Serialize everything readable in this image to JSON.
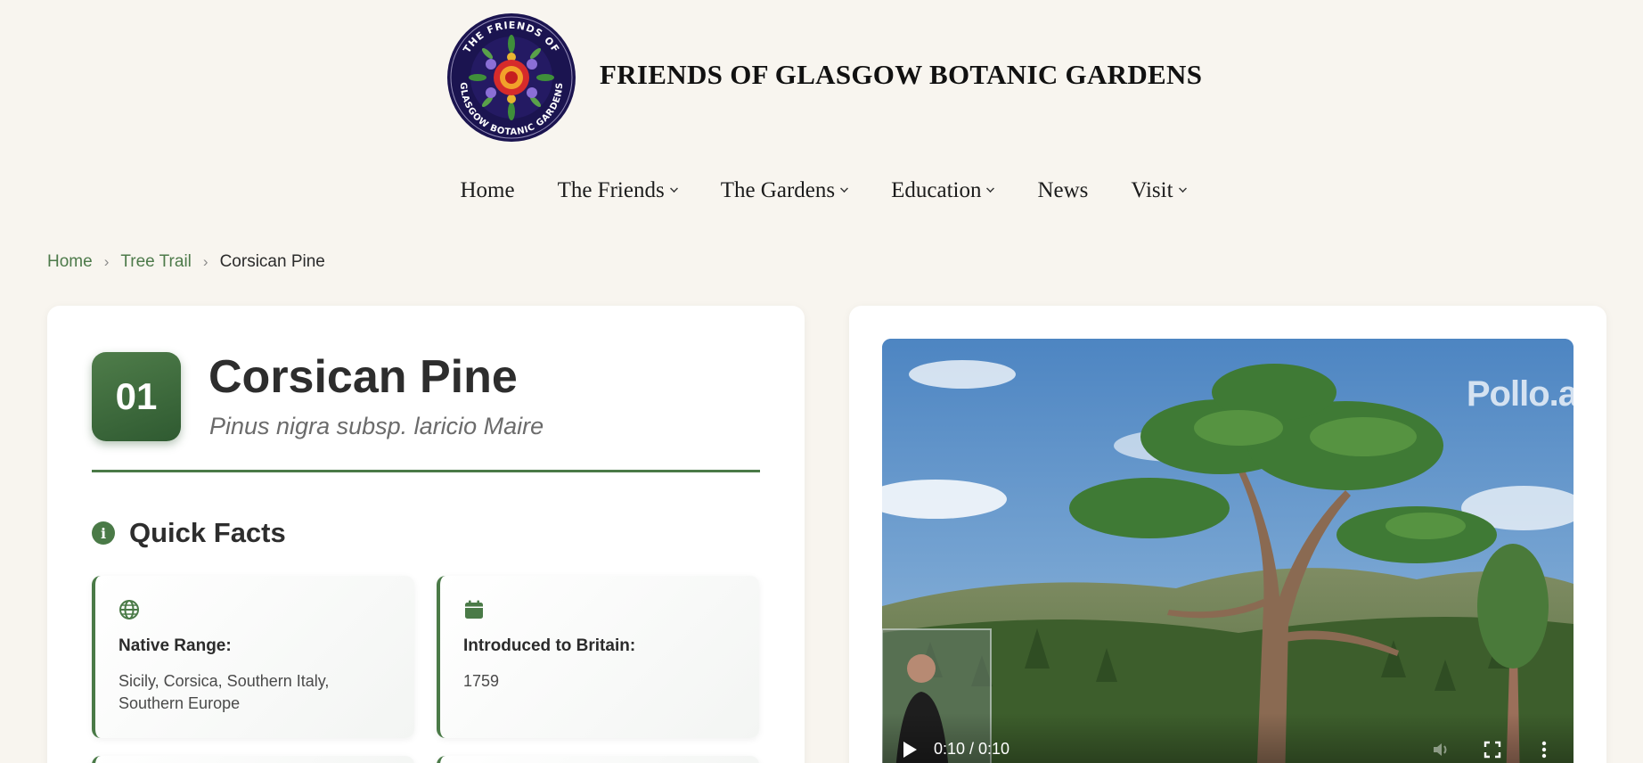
{
  "site": {
    "title": "FRIENDS OF GLASGOW BOTANIC GARDENS",
    "logo_alt": "THE FRIENDS OF GLASGOW BOTANIC GARDENS"
  },
  "nav": {
    "items": [
      {
        "label": "Home",
        "has_dropdown": false
      },
      {
        "label": "The Friends",
        "has_dropdown": true
      },
      {
        "label": "The Gardens",
        "has_dropdown": true
      },
      {
        "label": "Education",
        "has_dropdown": true
      },
      {
        "label": "News",
        "has_dropdown": false
      },
      {
        "label": "Visit",
        "has_dropdown": true
      }
    ]
  },
  "breadcrumb": {
    "items": [
      "Home",
      "Tree Trail"
    ],
    "separator": "›",
    "current": "Corsican Pine"
  },
  "tree": {
    "number": "01",
    "name": "Corsican Pine",
    "latin": "Pinus nigra subsp. laricio Maire"
  },
  "quick_facts": {
    "title": "Quick Facts",
    "icon": "info-icon",
    "facts": [
      {
        "icon": "globe-icon",
        "label": "Native Range:",
        "value": "Sicily, Corsica, Southern Italy, Southern Europe"
      },
      {
        "icon": "calendar-icon",
        "label": "Introduced to Britain:",
        "value": "1759"
      }
    ]
  },
  "video": {
    "watermark": "Pollo.a",
    "time": "0:10 / 0:10",
    "progress_percent": 100
  },
  "colors": {
    "accent": "#4a7a47",
    "background": "#f8f5ef",
    "card": "#ffffff"
  }
}
